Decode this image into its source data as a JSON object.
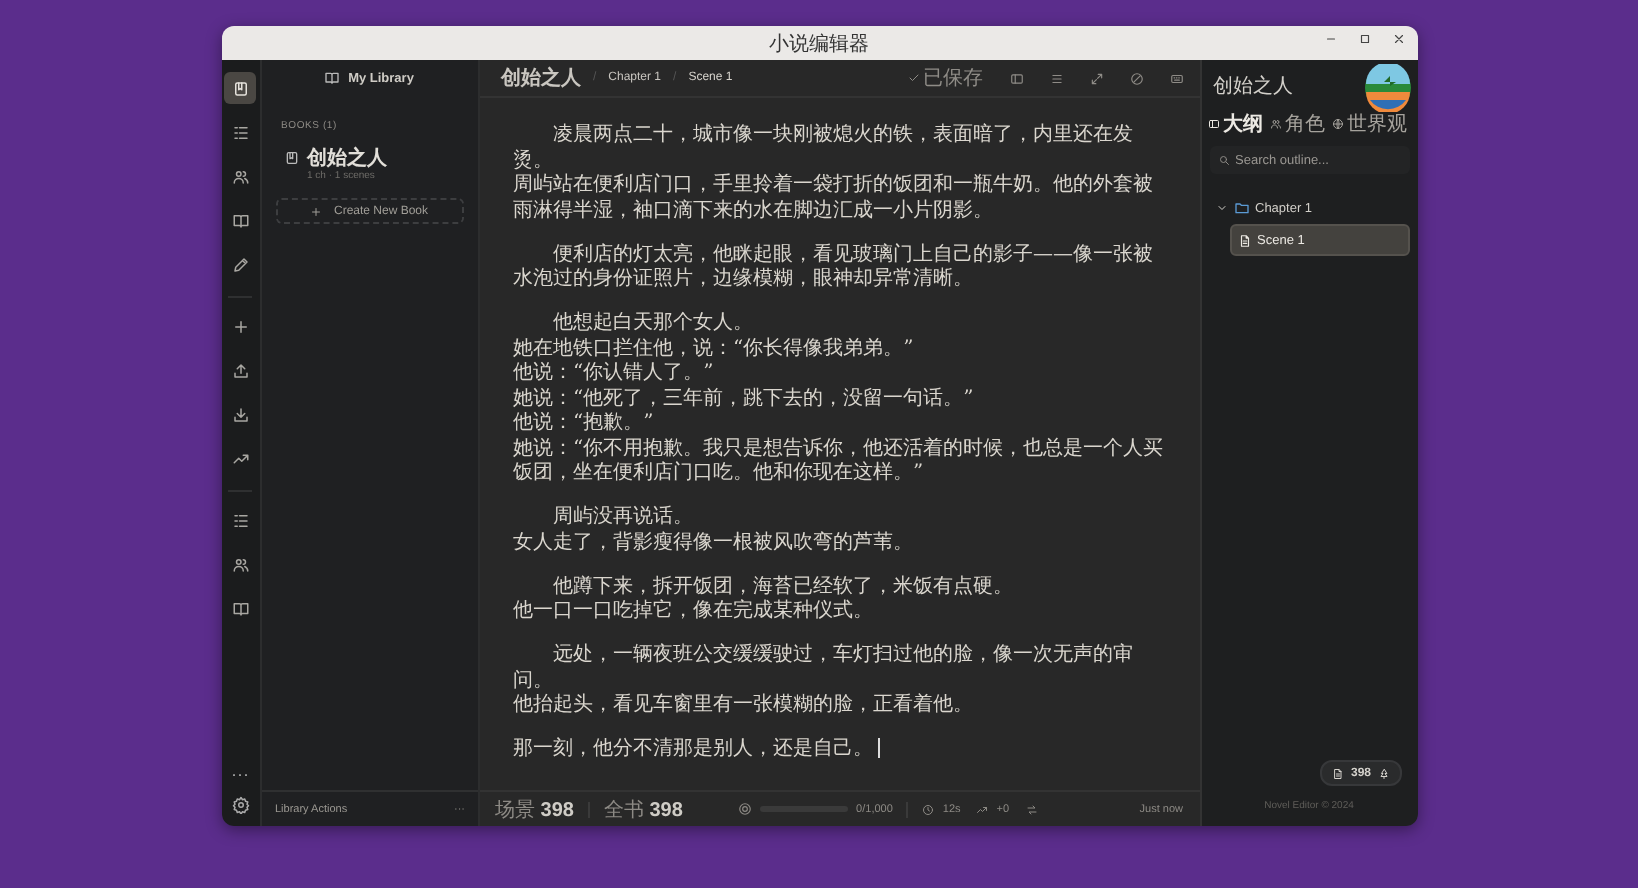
{
  "window": {
    "title": "小说编辑器"
  },
  "rail": {
    "items": [
      {
        "selected": true
      },
      {
        "selected": false
      },
      {
        "selected": false
      },
      {
        "selected": false
      },
      {
        "selected": false
      },
      {
        "selected": false
      },
      {
        "selected": false
      },
      {
        "selected": false
      },
      {
        "selected": false
      },
      {
        "selected": false
      },
      {
        "selected": false
      },
      {
        "selected": false
      }
    ],
    "more": "···"
  },
  "library": {
    "title": "My Library",
    "section": "BOOKS (1)",
    "books": [
      {
        "title": "创始之人",
        "meta": "1 ch · 1 scenes"
      }
    ],
    "create_button": "Create New Book",
    "footer": {
      "label": "Library Actions",
      "more": "···"
    }
  },
  "editor": {
    "breadcrumb": [
      {
        "kind": "crumb",
        "text": "创始之人"
      },
      {
        "kind": "sep",
        "text": "/"
      },
      {
        "kind": "crumb",
        "text": "Chapter 1"
      },
      {
        "kind": "sep",
        "text": "/"
      },
      {
        "kind": "current",
        "text": "Scene 1"
      }
    ],
    "save_status": "已保存",
    "paragraphs": [
      [
        "凌晨两点二十，城市像一块刚被熄火的铁，表面暗了，内里还在发烫。",
        "周屿站在便利店门口，手里拎着一袋打折的饭团和一瓶牛奶。他的外套被雨淋得半湿，袖口滴下来的水在脚边汇成一小片阴影。"
      ],
      [
        "便利店的灯太亮，他眯起眼，看见玻璃门上自己的影子——像一张被水泡过的身份证照片，边缘模糊，眼神却异常清晰。"
      ],
      [
        "他想起白天那个女人。",
        "她在地铁口拦住他，说：“你长得像我弟弟。”",
        "他说：“你认错人了。”",
        "她说：“他死了，三年前，跳下去的，没留一句话。”",
        "他说：“抱歉。”",
        "她说：“你不用抱歉。我只是想告诉你，他还活着的时候，也总是一个人买饭团，坐在便利店门口吃。他和你现在这样。”"
      ],
      [
        "周屿没再说话。",
        "女人走了，背影瘦得像一根被风吹弯的芦苇。"
      ],
      [
        "他蹲下来，拆开饭团，海苔已经软了，米饭有点硬。",
        "他一口一口吃掉它，像在完成某种仪式。"
      ],
      [
        "远处，一辆夜班公交缓缓驶过，车灯扫过他的脸，像一次无声的审问。",
        "他抬起头，看见车窗里有一张模糊的脸，正看着他。"
      ],
      [
        "那一刻，他分不清那是别人，还是自己。"
      ]
    ],
    "status_bar": {
      "scene_label": "场景",
      "scene_count": "398",
      "book_label": "全书",
      "book_count": "398",
      "goal": {
        "level": 0,
        "reading": "0/1,000"
      },
      "timer": "12s",
      "delta": "+0",
      "saved": "Just now"
    }
  },
  "outline": {
    "title": "创始之人",
    "tabs": [
      {
        "label": "大纲",
        "selected": true
      },
      {
        "label": "角色",
        "selected": false
      },
      {
        "label": "世界观",
        "selected": false
      }
    ],
    "search": {
      "placeholder": "Search outline..."
    },
    "tree": [
      {
        "label": "Chapter 1",
        "expanded": true,
        "selected": false,
        "children": [
          {
            "label": "Scene 1",
            "selected": true
          }
        ]
      }
    ],
    "word_count": "398",
    "footer": "Novel Editor © 2024"
  }
}
